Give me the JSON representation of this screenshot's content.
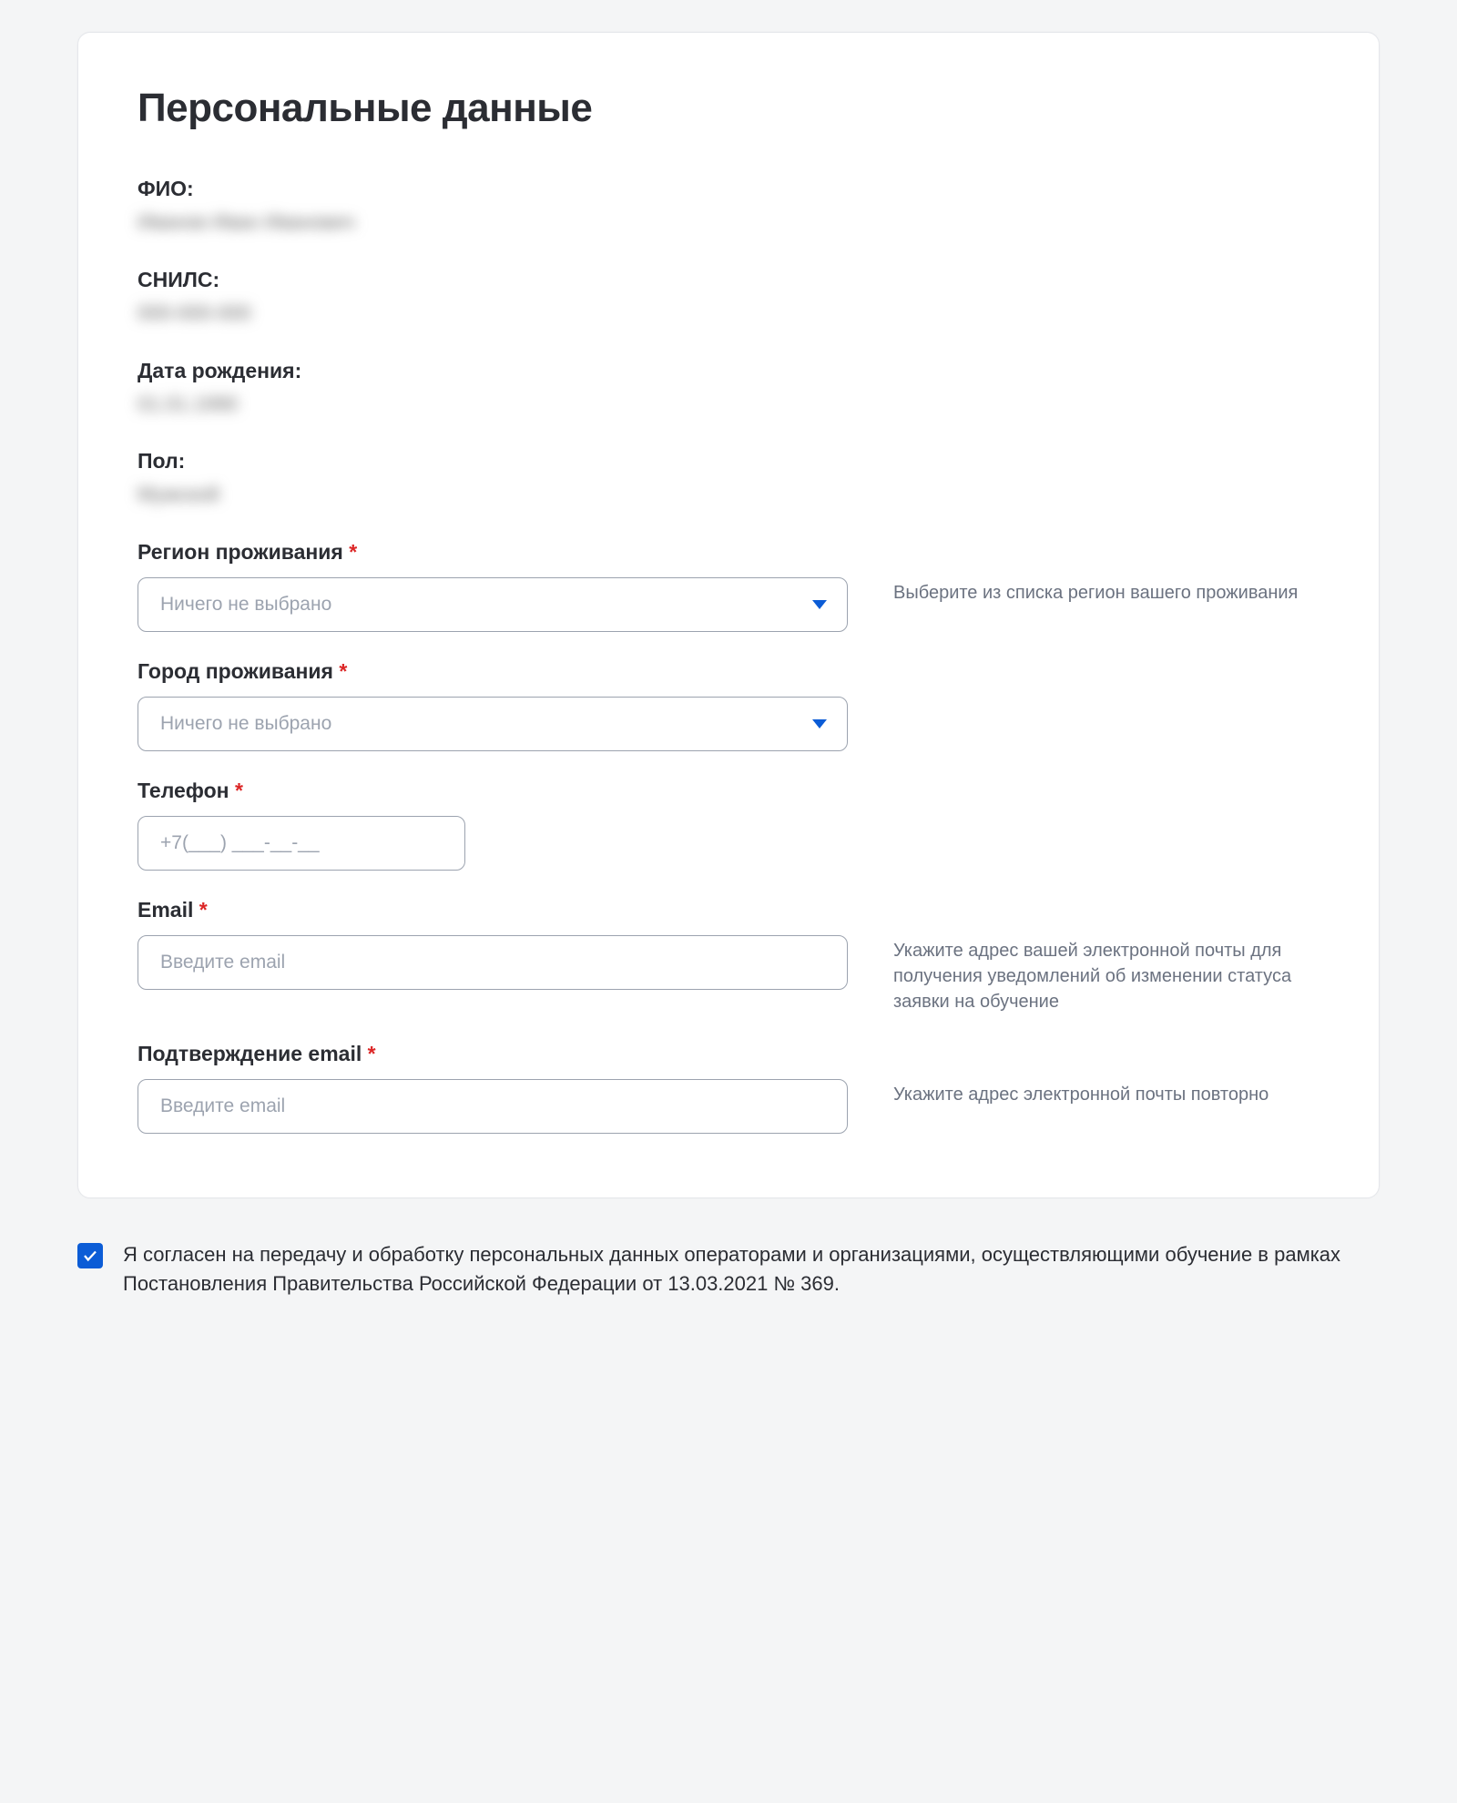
{
  "title": "Персональные данные",
  "readonly": {
    "fio_label": "ФИО:",
    "fio_value": "Иванов Иван Иванович",
    "snils_label": "СНИЛС:",
    "snils_value": "000-000-000",
    "dob_label": "Дата рождения:",
    "dob_value": "01.01.1990",
    "gender_label": "Пол:",
    "gender_value": "Мужской"
  },
  "fields": {
    "region": {
      "label": "Регион проживания",
      "placeholder": "Ничего не выбрано",
      "hint": "Выберите из списка регион вашего проживания"
    },
    "city": {
      "label": "Город проживания",
      "placeholder": "Ничего не выбрано"
    },
    "phone": {
      "label": "Телефон",
      "placeholder": "+7(___) ___-__-__"
    },
    "email": {
      "label": "Email",
      "placeholder": "Введите email",
      "hint": "Укажите адрес вашей электронной почты для получения уведомлений об изменении статуса заявки на обучение"
    },
    "email_confirm": {
      "label": "Подтверждение email",
      "placeholder": "Введите email",
      "hint": "Укажите адрес электронной почты повторно"
    }
  },
  "consent": {
    "checked": true,
    "text": "Я согласен на передачу и обработку персональных данных операторами и организациями, осуществляющими обучение в рамках Постановления Правительства Российской Федерации от 13.03.2021 № 369."
  },
  "required_marker": "*"
}
